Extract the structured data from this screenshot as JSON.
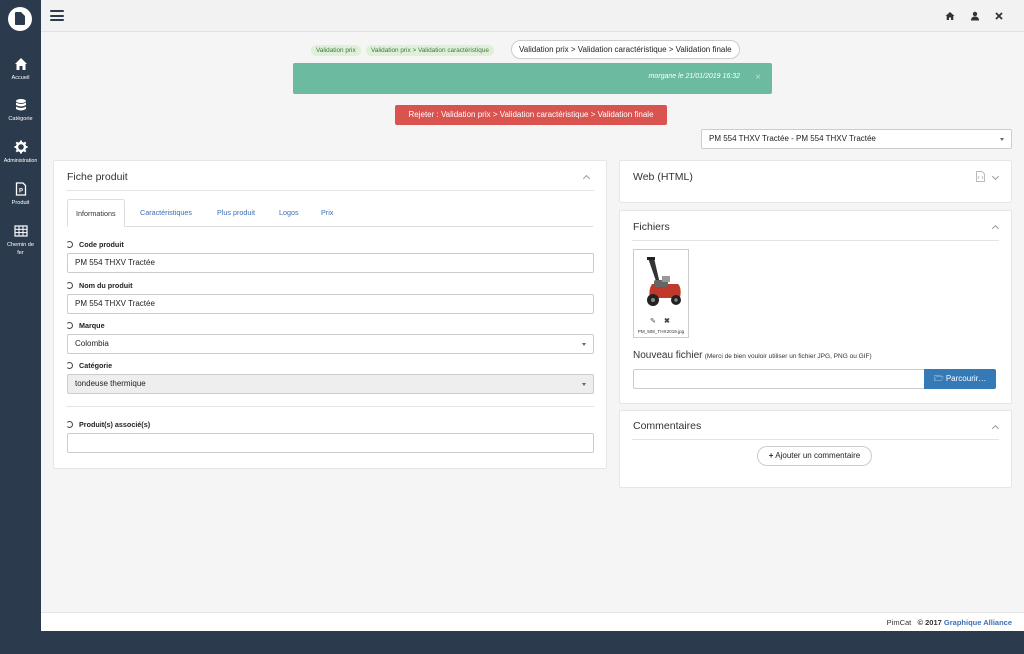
{
  "sidebar": {
    "items": [
      {
        "label": "Accueil",
        "icon": "home-icon"
      },
      {
        "label": "Catégorie",
        "icon": "database-icon"
      },
      {
        "label": "Administration",
        "icon": "gear-icon"
      },
      {
        "label": "Produit",
        "icon": "document-icon"
      },
      {
        "label": "Chemin de fer",
        "icon": "table-icon"
      }
    ]
  },
  "topbar": {
    "icons": [
      "menu-icon",
      "home-icon",
      "user-icon",
      "close-icon"
    ]
  },
  "workflow": {
    "step1": "Validation prix",
    "step2": "Validation prix > Validation caractéristique",
    "current": "Validation prix > Validation caractéristique > Validation finale"
  },
  "alert": {
    "message": "morgane le 21/01/2019 16:32",
    "close": "×"
  },
  "reject_button": "Rejeter : Validation prix > Validation caractéristique > Validation finale",
  "product_select": "PM 554 THXV Tractée - PM 554 THXV Tractée",
  "fiche": {
    "title": "Fiche produit",
    "tabs": [
      "Informations",
      "Caractéristiques",
      "Plus produit",
      "Logos",
      "Prix"
    ],
    "fields": {
      "code_label": "Code produit",
      "code_value": "PM 554 THXV Tractée",
      "nom_label": "Nom du produit",
      "nom_value": "PM 554 THXV Tractée",
      "marque_label": "Marque",
      "marque_value": "Colombia",
      "categorie_label": "Catégorie",
      "categorie_value": "tondeuse thermique",
      "associes_label": "Produit(s) associé(s)",
      "associes_value": ""
    }
  },
  "web": {
    "title": "Web (HTML)"
  },
  "fichiers": {
    "title": "Fichiers",
    "file_name": "PM_508_THX2019.jpg",
    "nouveau_label": "Nouveau fichier",
    "nouveau_hint": "(Merci de bien vouloir utiliser un fichier JPG, PNG ou GIF)",
    "browse": "Parcourir…"
  },
  "commentaires": {
    "title": "Commentaires",
    "add": "Ajouter un commentaire"
  },
  "footer": {
    "app": "PimCat",
    "copyright": "© 2017",
    "company": "Graphique Alliance"
  },
  "colors": {
    "sidebar": "#2b3a4d",
    "alert": "#6cbba1",
    "danger": "#d9534f",
    "primary": "#337ab7",
    "link": "#3b6fb6"
  }
}
